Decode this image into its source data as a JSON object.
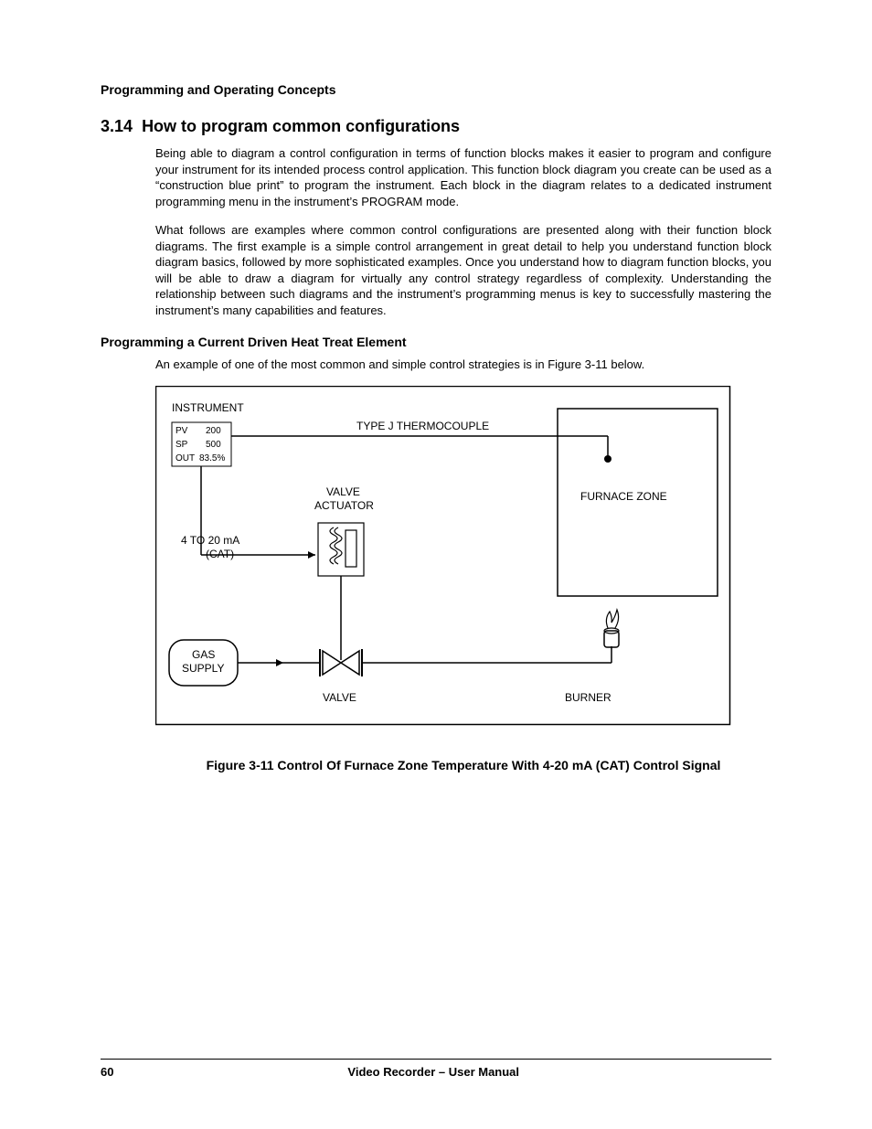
{
  "header": {
    "section": "Programming and Operating Concepts"
  },
  "heading": {
    "number": "3.14",
    "title": "How to program common configurations"
  },
  "paragraphs": {
    "p1": "Being able to diagram a control configuration in terms of function blocks makes it easier to program and configure your instrument for its intended process control application.  This function block diagram you create can be used as a “construction blue print” to program the instrument.  Each block in the diagram relates to a dedicated instrument programming menu in the instrument’s PROGRAM mode.",
    "p2": "What follows are examples where common control configurations are presented along with their function block diagrams.  The first example is a simple control arrangement in great detail to help you understand function block diagram basics, followed by more sophisticated examples.  Once you understand how to diagram function blocks, you will be able to draw a diagram for virtually any control strategy regardless of complexity.  Understanding the relationship between such diagrams and the instrument’s programming menus is key to successfully mastering the instrument’s many capabilities and features."
  },
  "subheading": "Programming a Current Driven Heat Treat Element",
  "example_intro": "An example of one of the most common and simple control strategies is in Figure 3-11 below.",
  "diagram": {
    "instrument_label": "INSTRUMENT",
    "display_rows": {
      "pv_label": "PV",
      "pv_value": "200",
      "sp_label": "SP",
      "sp_value": "500",
      "out_label": "OUT",
      "out_value": "83.5%"
    },
    "thermocouple_label": "TYPE J THERMOCOUPLE",
    "furnace_label": "FURNACE ZONE",
    "actuator_label_1": "VALVE",
    "actuator_label_2": "ACTUATOR",
    "signal_label_1": "4 TO 20 mA",
    "signal_label_2": "(CAT)",
    "gas_label_1": "GAS",
    "gas_label_2": "SUPPLY",
    "valve_label": "VALVE",
    "burner_label": "BURNER"
  },
  "figure_caption": "Figure 3-11   Control Of Furnace Zone Temperature With 4-20 mA (CAT) Control Signal",
  "footer": {
    "page_number": "60",
    "manual_title": "Video Recorder – User Manual"
  }
}
